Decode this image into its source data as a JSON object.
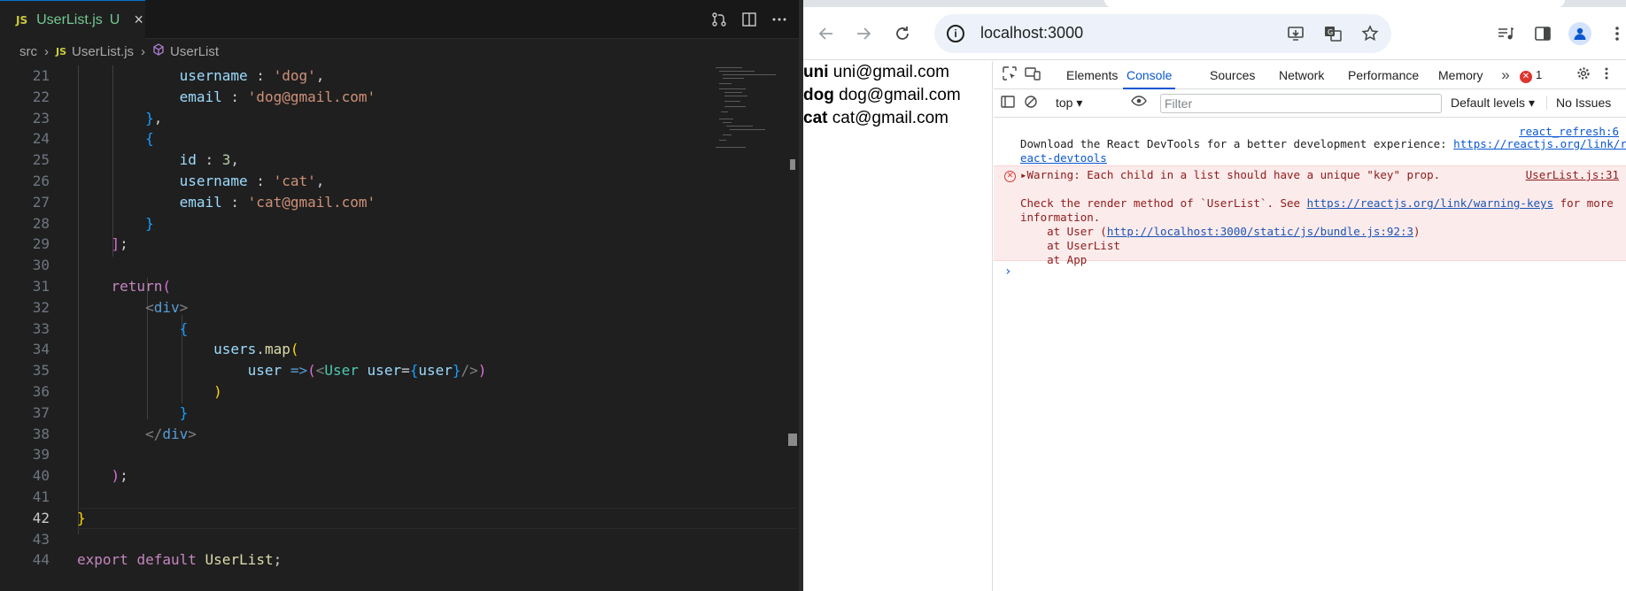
{
  "vscode": {
    "tab": {
      "icon_text": "JS",
      "filename": "UserList.js",
      "status": "U",
      "close": "×"
    },
    "actions": [
      "source-control-icon",
      "split-editor-icon",
      "more-actions-icon"
    ],
    "breadcrumb": {
      "folder": "src",
      "file_icon": "JS",
      "file": "UserList.js",
      "symbol": "UserList"
    },
    "active_line": 42,
    "lines": [
      {
        "n": "21",
        "html": "            <span class=\"k-var\">username</span> : <span class=\"k-str\">'dog'</span>,"
      },
      {
        "n": "22",
        "html": "            <span class=\"k-var\">email</span> : <span class=\"k-str\">'dog@gmail.com'</span>"
      },
      {
        "n": "23",
        "html": "        <span class=\"k-b3\">}</span>,"
      },
      {
        "n": "24",
        "html": "        <span class=\"k-b3\">{</span>"
      },
      {
        "n": "25",
        "html": "            <span class=\"k-var\">id</span> : <span class=\"k-num\">3</span>,"
      },
      {
        "n": "26",
        "html": "            <span class=\"k-var\">username</span> : <span class=\"k-str\">'cat'</span>,"
      },
      {
        "n": "27",
        "html": "            <span class=\"k-var\">email</span> : <span class=\"k-str\">'cat@gmail.com'</span>"
      },
      {
        "n": "28",
        "html": "        <span class=\"k-b3\">}</span>"
      },
      {
        "n": "29",
        "html": "    <span class=\"k-b2\">]</span>;"
      },
      {
        "n": "30",
        "html": ""
      },
      {
        "n": "31",
        "html": "    <span class=\"k-ctrl\">return</span><span class=\"k-b2\">(</span>"
      },
      {
        "n": "32",
        "html": "        <span class=\"k-tag\">&lt;</span><span class=\"k-tagn\">div</span><span class=\"k-tag\">&gt;</span>"
      },
      {
        "n": "33",
        "html": "            <span class=\"k-b3\">{</span>"
      },
      {
        "n": "34",
        "html": "                <span class=\"k-var\">users</span>.<span class=\"k-fn\">map</span><span class=\"k-b1\">(</span>"
      },
      {
        "n": "35",
        "html": "                    <span class=\"k-var\">user</span> <span class=\"k-kw\">=&gt;</span><span class=\"k-b2\">(</span><span class=\"k-tag\">&lt;</span><span class=\"k-comp\">User</span> <span class=\"k-var\">user</span>=<span class=\"k-b3\">{</span><span class=\"k-var\">user</span><span class=\"k-b3\">}</span><span class=\"k-tag\">/&gt;</span><span class=\"k-b2\">)</span>"
      },
      {
        "n": "36",
        "html": "                <span class=\"k-b1\">)</span>"
      },
      {
        "n": "37",
        "html": "            <span class=\"k-b3\">}</span>"
      },
      {
        "n": "38",
        "html": "        <span class=\"k-tag\">&lt;/</span><span class=\"k-tagn\">div</span><span class=\"k-tag\">&gt;</span>"
      },
      {
        "n": "39",
        "html": ""
      },
      {
        "n": "40",
        "html": "    <span class=\"k-b2\">)</span>;"
      },
      {
        "n": "41",
        "html": ""
      },
      {
        "n": "42",
        "html": "<span class=\"k-b1\">}</span>"
      },
      {
        "n": "43",
        "html": ""
      },
      {
        "n": "44",
        "html": "<span class=\"k-ctrl\">export</span> <span class=\"k-ctrl\">default</span> <span class=\"k-fn\">UserList</span>;"
      }
    ]
  },
  "browser": {
    "url": "localhost:3000",
    "page_users": [
      {
        "username": "uni",
        "email": "uni@gmail.com"
      },
      {
        "username": "dog",
        "email": "dog@gmail.com"
      },
      {
        "username": "cat",
        "email": "cat@gmail.com"
      }
    ],
    "devtools": {
      "tabs": [
        "Elements",
        "Console",
        "Sources",
        "Network",
        "Performance",
        "Memory"
      ],
      "active_tab": "Console",
      "error_count": "1",
      "context": "top",
      "filter_placeholder": "Filter",
      "levels": "Default levels",
      "issues": "No Issues",
      "info_source": "react_refresh:6",
      "info_text": "Download the React DevTools for a better development experience: ",
      "info_link_1": "https://reactjs.org/link/r",
      "info_link_2": "eact-devtools",
      "warn_source": "UserList.js:31",
      "warn_title": "Warning: Each child in a list should have a unique \"key\" prop.",
      "warn_check_pre": "Check the render method of `UserList`. See ",
      "warn_check_link": "https://reactjs.org/link/warning-keys",
      "warn_check_post": " for more",
      "warn_info": "information.",
      "stack_1_pre": "    at User (",
      "stack_1_link": "http://localhost:3000/static/js/bundle.js:92:3",
      "stack_1_post": ")",
      "stack_2": "    at UserList",
      "stack_3": "    at App",
      "prompt": "›"
    }
  }
}
